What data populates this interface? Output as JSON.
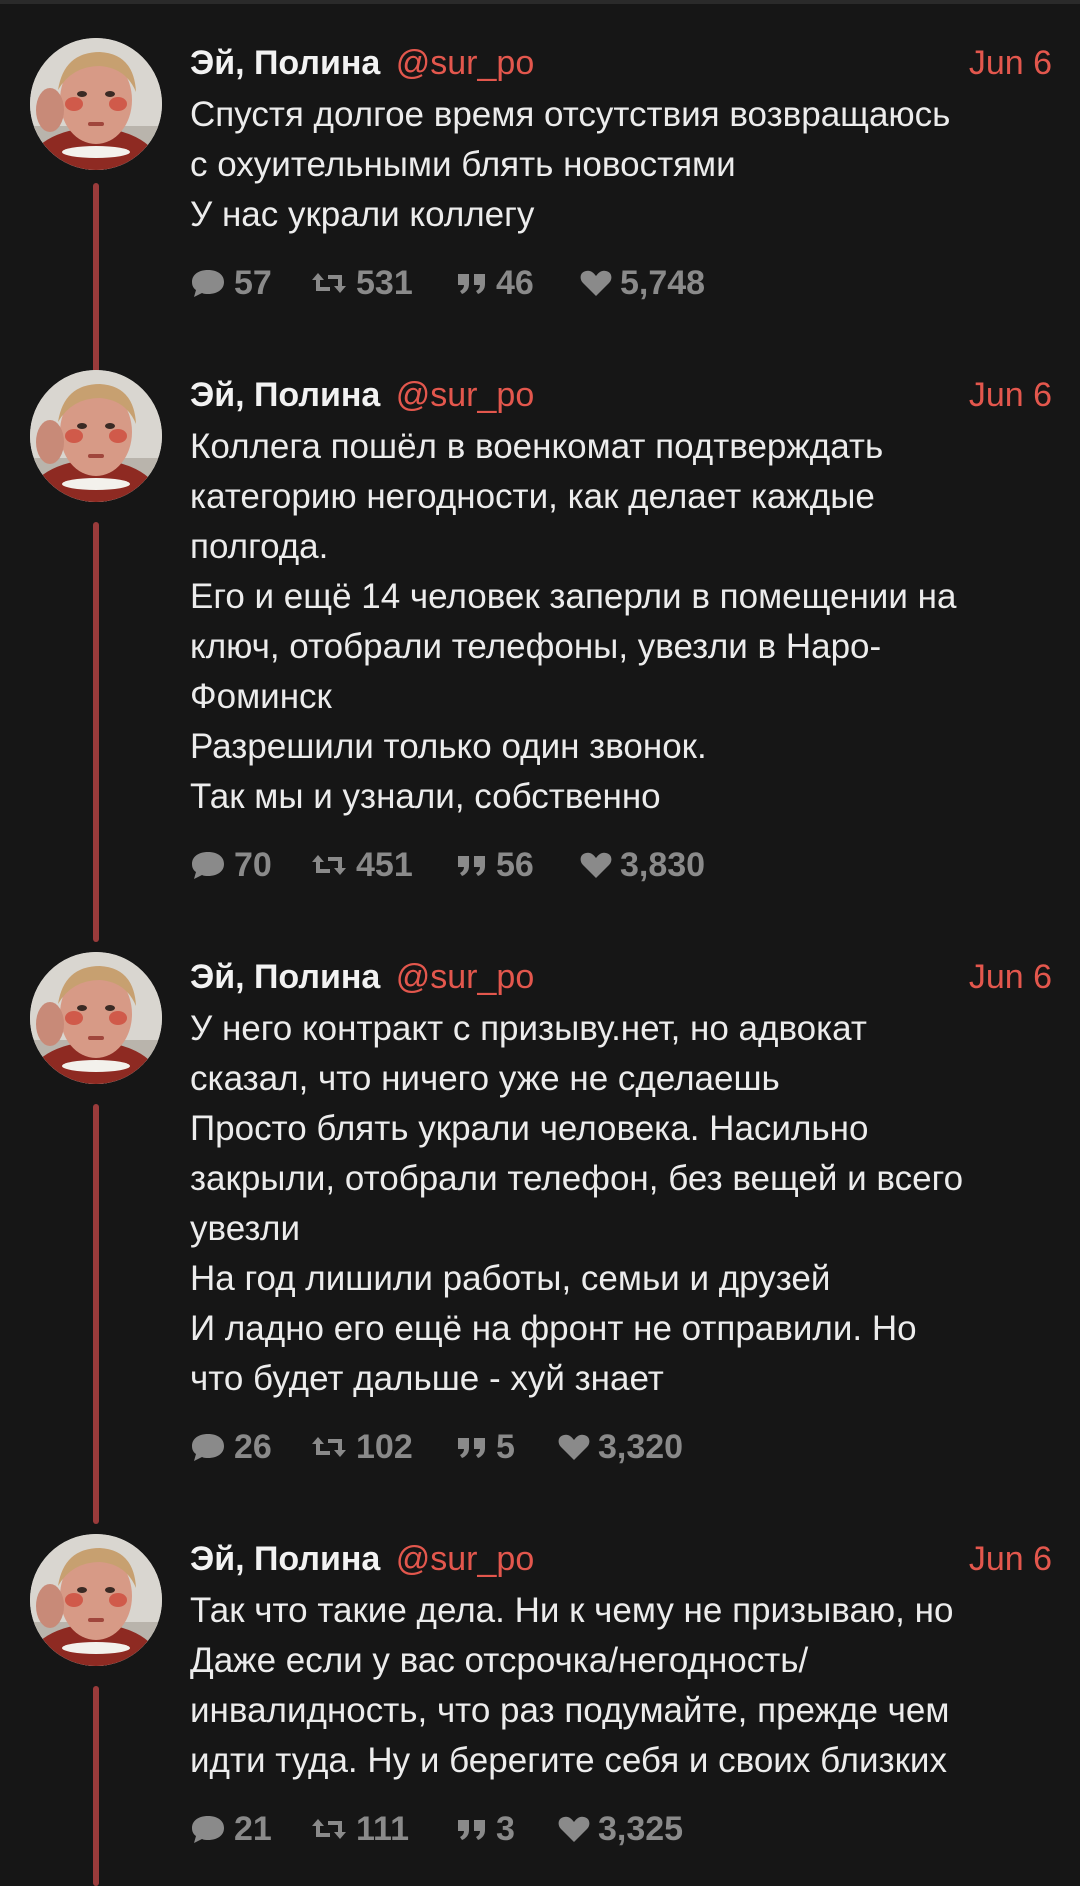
{
  "tweets": [
    {
      "author": "Эй, Полина",
      "handle": "@sur_po",
      "date": "Jun 6",
      "lines": [
        "Спустя долгое время отсутствия возвращаюсь",
        "с охуительными блять новостями",
        "У нас украли коллегу"
      ],
      "stats": {
        "replies": "57",
        "retweets": "531",
        "quotes": "46",
        "likes": "5,748"
      }
    },
    {
      "author": "Эй, Полина",
      "handle": "@sur_po",
      "date": "Jun 6",
      "lines": [
        "Коллега пошёл в военкомат подтверждать",
        "категорию негодности, как делает каждые",
        "полгода.",
        "Его и ещё 14 человек заперли в помещении на",
        "ключ, отобрали телефоны, увезли в Наро-",
        "Фоминск",
        "Разрешили только один звонок.",
        "Так мы и узнали, собственно"
      ],
      "stats": {
        "replies": "70",
        "retweets": "451",
        "quotes": "56",
        "likes": "3,830"
      }
    },
    {
      "author": "Эй, Полина",
      "handle": "@sur_po",
      "date": "Jun 6",
      "lines": [
        "У него контракт с призыву.нет, но адвокат",
        "сказал, что ничего уже не сделаешь",
        "Просто блять украли человека. Насильно",
        "закрыли, отобрали телефон, без вещей и всего",
        "увезли",
        "На год лишили работы, семьи и друзей",
        "И ладно его ещё на фронт не отправили. Но",
        "что будет дальше - хуй знает"
      ],
      "stats": {
        "replies": "26",
        "retweets": "102",
        "quotes": "5",
        "likes": "3,320"
      }
    },
    {
      "author": "Эй, Полина",
      "handle": "@sur_po",
      "date": "Jun 6",
      "lines": [
        "Так что такие дела. Ни к чему не призываю, но",
        "Даже если у вас отсрочка/негодность/",
        "инвалидность, что раз подумайте, прежде чем",
        "идти туда. Ну и берегите себя и своих близких"
      ],
      "stats": {
        "replies": "21",
        "retweets": "111",
        "quotes": "3",
        "likes": "3,325"
      }
    }
  ],
  "colors": {
    "background": "#161616",
    "accent": "#e3574d",
    "thread_line": "#9a3b3b",
    "muted": "#8a8a8a"
  },
  "icons": {
    "reply": "speech-bubble-icon",
    "retweet": "retweet-icon",
    "quote": "quote-icon",
    "like": "heart-icon"
  }
}
